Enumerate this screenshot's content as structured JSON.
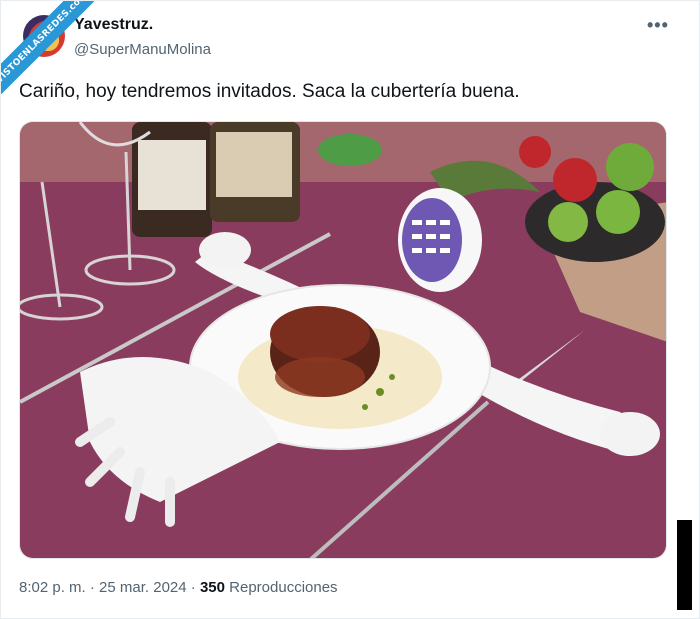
{
  "watermark": {
    "text": "VISTOENLASREDES",
    "subtext": ".com"
  },
  "tweet": {
    "display_name": "Yavestruz.",
    "handle": "@SuperManuMolina",
    "more_label": "•••",
    "text": "Cariño, hoy tendremos invitados. Saca la cubertería buena.",
    "time": "8:02 p. m.",
    "sep1": " · ",
    "date": "25 mar. 2024",
    "sep2": " · ",
    "views_count": "350",
    "views_label": " Reproducciones"
  },
  "colors": {
    "accent": "#2a97d6",
    "tablecloth": "#8a3c5e",
    "secondary_text": "#536471"
  },
  "icons": {
    "more": "more-dots-icon"
  }
}
